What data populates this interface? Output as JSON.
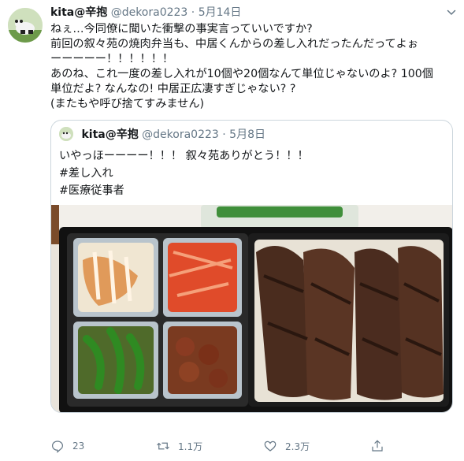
{
  "tweet": {
    "display_name": "kita@辛抱",
    "handle": "@dekora0223",
    "separator": "·",
    "date": "5月14日",
    "lines": [
      "ねぇ…今同僚に聞いた衝撃の事実言っていいですか?",
      "前回の叙々苑の焼肉弁当も、中居くんからの差し入れだったんだってよぉ",
      "ーーーーー！！！！！！",
      "あのね、これ一度の差し入れが10個や20個なんて単位じゃないのよ? 100個",
      "単位だよ? なんなの! 中居正広凄すぎじゃない? ?",
      "(またもや呼び捨てすみません)"
    ]
  },
  "quoted": {
    "display_name": "kita@辛抱",
    "handle": "@dekora0223",
    "separator": "·",
    "date": "5月8日",
    "lines": [
      "いやっほーーーー！！！ 叙々苑ありがとう！！！",
      "#差し入れ",
      "#医療従事者"
    ]
  },
  "actions": {
    "reply_count": "23",
    "retweet_count": "1.1万",
    "like_count": "2.3万"
  },
  "icons": {
    "reply": "reply-icon",
    "retweet": "retweet-icon",
    "like": "heart-icon",
    "share": "share-icon",
    "more": "chevron-down-icon"
  },
  "colors": {
    "text": "#14171a",
    "muted": "#657786",
    "border": "#ccd6dd"
  }
}
